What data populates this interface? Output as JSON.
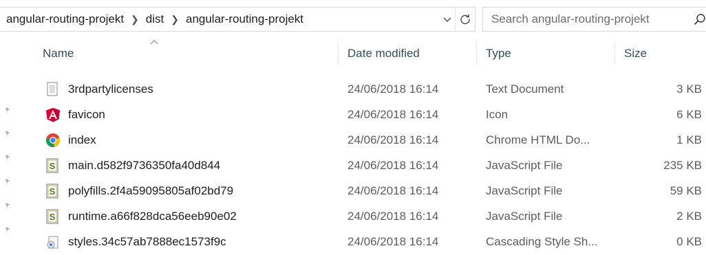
{
  "address_bar": {
    "crumbs": [
      "angular-routing-projekt",
      "dist",
      "angular-routing-projekt"
    ]
  },
  "search": {
    "placeholder": "Search angular-routing-projekt"
  },
  "columns": {
    "name": "Name",
    "date": "Date modified",
    "type": "Type",
    "size": "Size"
  },
  "files": [
    {
      "name": "3rdpartylicenses",
      "date": "24/06/2018 16:14",
      "type": "Text Document",
      "size": "3 KB",
      "icon": "text-document-icon"
    },
    {
      "name": "favicon",
      "date": "24/06/2018 16:14",
      "type": "Icon",
      "size": "6 KB",
      "icon": "angular-icon"
    },
    {
      "name": "index",
      "date": "24/06/2018 16:14",
      "type": "Chrome HTML Do...",
      "size": "1 KB",
      "icon": "chrome-icon"
    },
    {
      "name": "main.d582f9736350fa40d844",
      "date": "24/06/2018 16:14",
      "type": "JavaScript File",
      "size": "235 KB",
      "icon": "script-file-icon"
    },
    {
      "name": "polyfills.2f4a59095805af02bd79",
      "date": "24/06/2018 16:14",
      "type": "JavaScript File",
      "size": "59 KB",
      "icon": "script-file-icon"
    },
    {
      "name": "runtime.a66f828dca56eeb90e02",
      "date": "24/06/2018 16:14",
      "type": "JavaScript File",
      "size": "2 KB",
      "icon": "script-file-icon"
    },
    {
      "name": "styles.34c57ab7888ec1573f9c",
      "date": "24/06/2018 16:14",
      "type": "Cascading Style Sh...",
      "size": "0 KB",
      "icon": "css-file-icon"
    }
  ]
}
